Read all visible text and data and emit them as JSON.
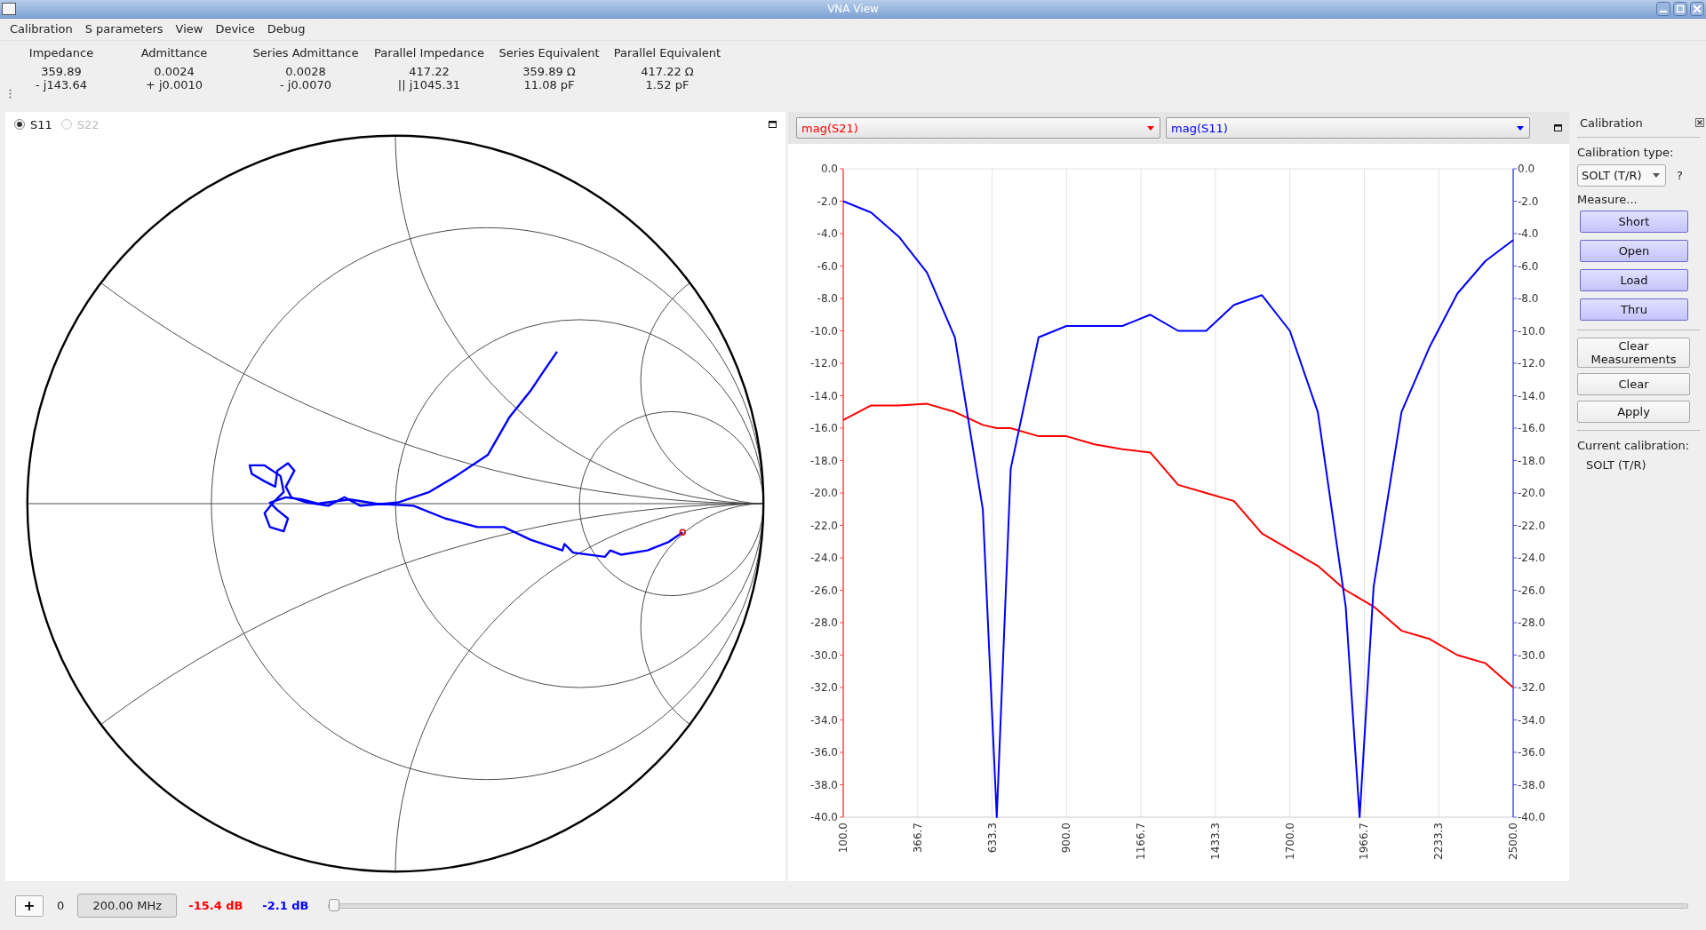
{
  "window": {
    "title": "VNA View"
  },
  "menu": [
    "Calibration",
    "S parameters",
    "View",
    "Device",
    "Debug"
  ],
  "readouts": [
    {
      "heading": "Impedance",
      "line_1": "359.89",
      "line_2": "- j143.64"
    },
    {
      "heading": "Admittance",
      "line_1": "0.0024",
      "line_2": "+ j0.0010"
    },
    {
      "heading": "Series Admittance",
      "line_1": "0.0028",
      "line_2": "- j0.0070"
    },
    {
      "heading": "Parallel Impedance",
      "line_1": "417.22",
      "line_2": "|| j1045.31"
    },
    {
      "heading": "Series Equivalent",
      "line_1": "359.89 Ω",
      "line_2": "11.08 pF"
    },
    {
      "heading": "Parallel Equivalent",
      "line_1": "417.22 Ω",
      "line_2": "1.52 pF"
    }
  ],
  "smith": {
    "ports": [
      {
        "label": "S11",
        "selected": true,
        "disabled": false
      },
      {
        "label": "S22",
        "selected": false,
        "disabled": true
      }
    ]
  },
  "plot": {
    "chart_data": {
      "type": "line",
      "grid": true,
      "x": [
        100,
        200,
        300,
        400,
        500,
        600,
        650,
        700,
        800,
        900,
        1000,
        1100,
        1200,
        1300,
        1400,
        1500,
        1600,
        1700,
        1800,
        1900,
        1950,
        2000,
        2100,
        2200,
        2300,
        2400,
        2500
      ],
      "series": [
        {
          "name": "mag(S21)",
          "color": "#ff0000",
          "values": [
            -15.5,
            -14.6,
            -14.6,
            -14.5,
            -15,
            -15.8,
            -16,
            -16,
            -16.5,
            -16.5,
            -17,
            -17.3,
            -17.5,
            -19.5,
            -20,
            -20.5,
            -22.5,
            -23.5,
            -24.5,
            -26,
            -26.5,
            -27,
            -28.5,
            -29,
            -30,
            -30.5,
            -32
          ]
        },
        {
          "name": "mag(S11)",
          "color": "#0000ff",
          "values": [
            -2,
            -2.7,
            -4.2,
            -6.4,
            -10.4,
            -21,
            -40,
            -18.5,
            -10.4,
            -9.7,
            -9.7,
            -9.7,
            -9,
            -10,
            -10,
            -8.4,
            -7.8,
            -10,
            -15,
            -27,
            -40,
            -25.8,
            -15,
            -11,
            -7.7,
            -5.7,
            -4.4
          ]
        }
      ],
      "xlim": [
        100,
        2500
      ],
      "ylim": [
        -40,
        0
      ],
      "xticks": [
        {
          "value": 100,
          "label": "100.0"
        },
        {
          "value": 366.7,
          "label": "366.7"
        },
        {
          "value": 633.3,
          "label": "633.3"
        },
        {
          "value": 900,
          "label": "900.0"
        },
        {
          "value": 1166.7,
          "label": "1166.7"
        },
        {
          "value": 1433.3,
          "label": "1433.3"
        },
        {
          "value": 1700,
          "label": "1700.0"
        },
        {
          "value": 1966.7,
          "label": "1966.7"
        },
        {
          "value": 2233.3,
          "label": "2233.3"
        },
        {
          "value": 2500,
          "label": "2500.0"
        }
      ],
      "yticks": [
        {
          "value": 0,
          "label": "0.0"
        },
        {
          "value": -2,
          "label": "-2.0"
        },
        {
          "value": -4,
          "label": "-4.0"
        },
        {
          "value": -6,
          "label": "-6.0"
        },
        {
          "value": -8,
          "label": "-8.0"
        },
        {
          "value": -10,
          "label": "-10.0"
        },
        {
          "value": -12,
          "label": "-12.0"
        },
        {
          "value": -14,
          "label": "-14.0"
        },
        {
          "value": -16,
          "label": "-16.0"
        },
        {
          "value": -18,
          "label": "-18.0"
        },
        {
          "value": -20,
          "label": "-20.0"
        },
        {
          "value": -22,
          "label": "-22.0"
        },
        {
          "value": -24,
          "label": "-24.0"
        },
        {
          "value": -26,
          "label": "-26.0"
        },
        {
          "value": -28,
          "label": "-28.0"
        },
        {
          "value": -30,
          "label": "-30.0"
        },
        {
          "value": -32,
          "label": "-32.0"
        },
        {
          "value": -34,
          "label": "-34.0"
        },
        {
          "value": -36,
          "label": "-36.0"
        },
        {
          "value": -38,
          "label": "-38.0"
        },
        {
          "value": -40,
          "label": "-40.0"
        }
      ]
    }
  },
  "calibration": {
    "title": "Calibration",
    "type_label": "Calibration type:",
    "type_value": "SOLT (T/R)",
    "help": "?",
    "measure_label": "Measure...",
    "buttons": [
      {
        "label": "Short",
        "kind": "measure"
      },
      {
        "label": "Open",
        "kind": "measure"
      },
      {
        "label": "Load",
        "kind": "measure"
      },
      {
        "label": "Thru",
        "kind": "measure"
      },
      {
        "label": "Clear Measurements",
        "kind": "action"
      },
      {
        "label": "Clear",
        "kind": "action"
      },
      {
        "label": "Apply",
        "kind": "action"
      }
    ],
    "current_label": "Current calibration:",
    "current_value": "SOLT (T/R)"
  },
  "marker_bar": {
    "add": "+",
    "index": "0",
    "frequency": "200.00 MHz",
    "readings": [
      {
        "text": "-15.4 dB",
        "color": "#ff0000"
      },
      {
        "text": "-2.1 dB",
        "color": "#0000ff"
      }
    ],
    "slider": {
      "level": 0
    }
  }
}
